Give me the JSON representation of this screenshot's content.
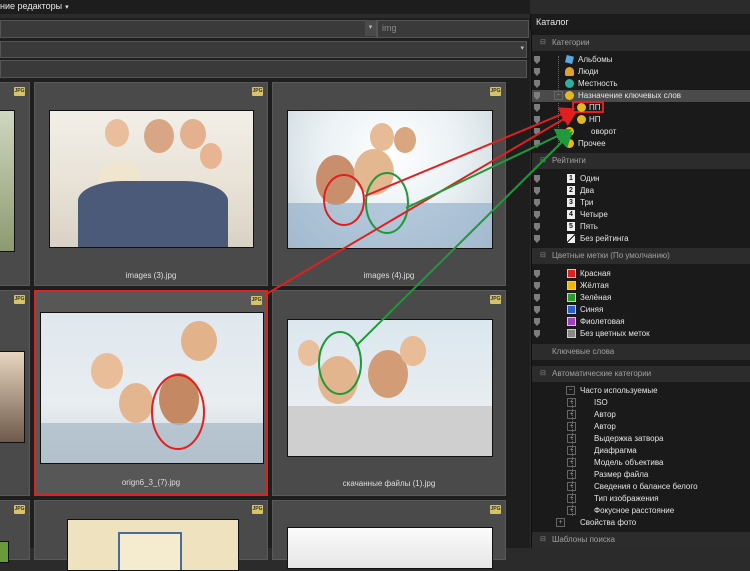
{
  "topbar": {
    "menu_label": "ние редакторы",
    "caret": "▾"
  },
  "catalog": {
    "title": "Каталог"
  },
  "filters": {
    "img_placeholder": "img"
  },
  "grid": {
    "badge": "JPG",
    "row1": [
      {
        "caption": "images (3).jpg"
      },
      {
        "caption": "images (4).jpg"
      }
    ],
    "row2": [
      {
        "caption": "orign6_3_(7).jpg"
      },
      {
        "caption": "скачанные файлы (1).jpg"
      }
    ]
  },
  "panel": {
    "categories": {
      "header": "Категории",
      "items": [
        "Альбомы",
        "Люди",
        "Местность",
        "Назначение ключевых слов",
        "ПП",
        "НП",
        "оворот",
        "Прочее"
      ]
    },
    "ratings": {
      "header": "Рейтинги",
      "items": [
        {
          "num": "1",
          "label": "Один"
        },
        {
          "num": "2",
          "label": "Два"
        },
        {
          "num": "3",
          "label": "Три"
        },
        {
          "num": "4",
          "label": "Четыре"
        },
        {
          "num": "5",
          "label": "Пять"
        },
        {
          "num": "",
          "label": "Без рейтинга"
        }
      ]
    },
    "colors": {
      "header": "Цветные метки (По умолчанию)",
      "items": [
        {
          "label": "Красная",
          "color": "#e02020"
        },
        {
          "label": "Жёлтая",
          "color": "#f0b800"
        },
        {
          "label": "Зелёная",
          "color": "#2e9a2e"
        },
        {
          "label": "Синяя",
          "color": "#2a5fd0"
        },
        {
          "label": "Фиолетовая",
          "color": "#a040c0"
        },
        {
          "label": "Без цветных меток",
          "color": "#888888"
        }
      ]
    },
    "keywords": {
      "header": "Ключевые слова"
    },
    "auto": {
      "header": "Автоматические категории",
      "top": "Часто используемые",
      "items": [
        "ISO",
        "Автор",
        "Автор",
        "Выдержка затвора",
        "Диафрагма",
        "Модель объектива",
        "Размер файла",
        "Сведения о балансе белого",
        "Тип изображения",
        "Фокусное расстояние"
      ],
      "extra": "Свойства фото"
    },
    "templates": {
      "header": "Шаблоны поиска"
    }
  },
  "annotations": {
    "red": "#e02020",
    "green": "#1f9a3a"
  }
}
